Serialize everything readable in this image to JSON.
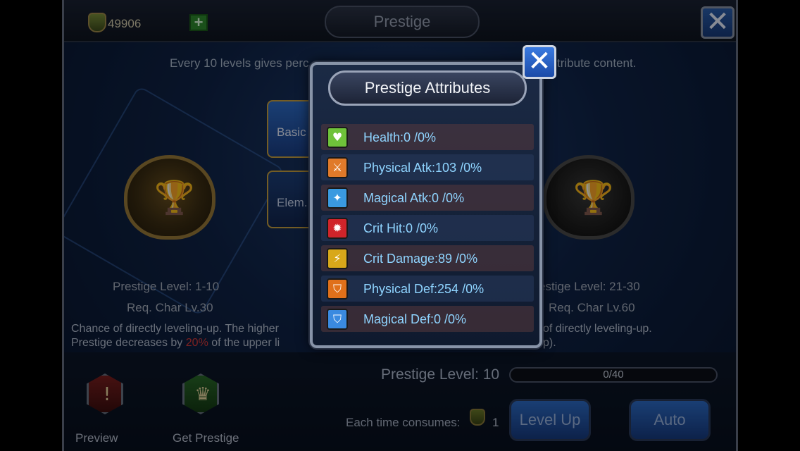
{
  "header": {
    "currency_value": "49906",
    "plus_icon": "+",
    "title": "Prestige",
    "close_icon": "✕"
  },
  "intro": {
    "line_left": "Every 10 levels gives perc",
    "line_right": "tribute content."
  },
  "tabs": [
    {
      "label": "Basic"
    },
    {
      "label": "Elem."
    }
  ],
  "left_card": {
    "level": "Prestige Level: 1-10",
    "req": "Req. Char Lv.30",
    "desc1": "Chance of directly leveling-up. The higher",
    "desc2a": "Prestige decreases by",
    "desc2b": "20%",
    "desc2c": "of the upper li"
  },
  "right_card": {
    "level": "estige Level: 21-30",
    "req": "Req. Char Lv.60",
    "desc1": "of directly leveling-up.",
    "desc2": "p)."
  },
  "bottom": {
    "preview_label": "Preview",
    "get_prestige_label": "Get Prestige",
    "prestige_level": "Prestige Level: 10",
    "progress_text": "0/40",
    "progress_fraction": 0,
    "consume_label": "Each time consumes:",
    "consume_count": "1",
    "level_up": "Level Up",
    "auto": "Auto"
  },
  "modal": {
    "title": "Prestige Attributes",
    "close_icon": "✕",
    "attributes": [
      {
        "text": "Health:0 /0%",
        "icon": "health-icon",
        "color": "#6fc23a"
      },
      {
        "text": "Physical Atk:103 /0%",
        "icon": "sword-icon",
        "color": "#e07a2a"
      },
      {
        "text": "Magical Atk:0 /0%",
        "icon": "magic-icon",
        "color": "#3a9ae0"
      },
      {
        "text": "Crit Hit:0 /0%",
        "icon": "crit-icon",
        "color": "#d0242a"
      },
      {
        "text": "Crit Damage:89 /0%",
        "icon": "lightning-icon",
        "color": "#d8a81a"
      },
      {
        "text": "Physical Def:254 /0%",
        "icon": "shield-icon",
        "color": "#e0701a"
      },
      {
        "text": "Magical Def:0 /0%",
        "icon": "magic-shield-icon",
        "color": "#3a8ae0"
      }
    ]
  }
}
